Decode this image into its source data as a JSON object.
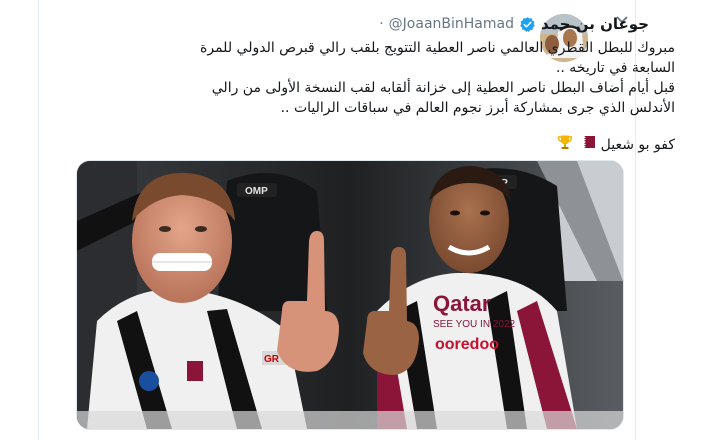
{
  "tweet": {
    "display_name": "جوعان بن حمد",
    "handle": "@JoaanBinHamad",
    "separator": "·",
    "lines": [
      "مبروك للبطل القطري العالمي ناصر العطية التتويج بلقب رالي قبرص الدولي للمرة",
      "السابعة في تاريخه ..",
      "قبل أيام أضاف البطل ناصر العطية إلى خزانة ألقابه لقب النسخة الأولى من رالي",
      "الأندلس الذي جرى بمشاركة أبرز نجوم العالم في سباقات الراليات ..",
      "كفو بو شعيل"
    ],
    "emoji": [
      "qatar-flag-icon",
      "trophy-icon"
    ],
    "photo_caption_text": {
      "helmet_left": "OMP",
      "helmet_right": "OMP",
      "suit_right": "Qatar",
      "suit_right_sub": "SEE YOU IN 2022",
      "suit_right_sponsor": "ooredoo",
      "suit_left_brand": "GR"
    }
  },
  "colors": {
    "verified": "#1da1f2",
    "text": "#14171a",
    "muted": "#657786",
    "qatar_maroon": "#8a1538",
    "suit_white": "#f0f0f0"
  }
}
